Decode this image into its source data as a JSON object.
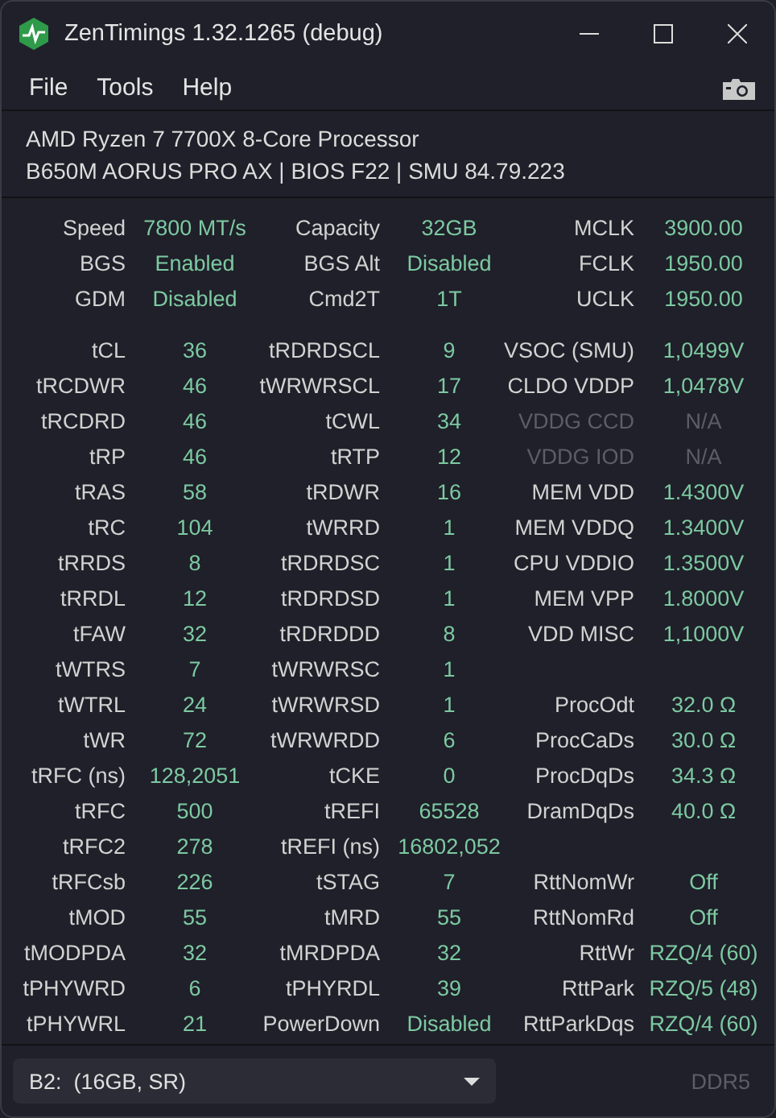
{
  "window": {
    "title": "ZenTimings 1.32.1265 (debug)"
  },
  "menu": [
    "File",
    "Tools",
    "Help"
  ],
  "info": {
    "cpu": "AMD Ryzen 7 7700X 8-Core Processor",
    "board": "B650M AORUS PRO AX | BIOS F22 | SMU 84.79.223"
  },
  "summary": [
    [
      {
        "label": "Speed",
        "value": "7800 MT/s",
        "disabled": false
      },
      {
        "label": "Capacity",
        "value": "32GB",
        "disabled": false
      },
      {
        "label": "MCLK",
        "value": "3900.00",
        "disabled": false
      }
    ],
    [
      {
        "label": "BGS",
        "value": "Enabled",
        "disabled": false
      },
      {
        "label": "BGS Alt",
        "value": "Disabled",
        "disabled": false
      },
      {
        "label": "FCLK",
        "value": "1950.00",
        "disabled": false
      }
    ],
    [
      {
        "label": "GDM",
        "value": "Disabled",
        "disabled": false
      },
      {
        "label": "Cmd2T",
        "value": "1T",
        "disabled": false
      },
      {
        "label": "UCLK",
        "value": "1950.00",
        "disabled": false
      }
    ]
  ],
  "timings": [
    [
      {
        "label": "tCL",
        "value": "36",
        "disabled": false
      },
      {
        "label": "tRDRDSCL",
        "value": "9",
        "disabled": false
      },
      {
        "label": "VSOC (SMU)",
        "value": "1,0499V",
        "disabled": false
      }
    ],
    [
      {
        "label": "tRCDWR",
        "value": "46",
        "disabled": false
      },
      {
        "label": "tWRWRSCL",
        "value": "17",
        "disabled": false
      },
      {
        "label": "CLDO VDDP",
        "value": "1,0478V",
        "disabled": false
      }
    ],
    [
      {
        "label": "tRCDRD",
        "value": "46",
        "disabled": false
      },
      {
        "label": "tCWL",
        "value": "34",
        "disabled": false
      },
      {
        "label": "VDDG CCD",
        "value": "N/A",
        "disabled": true
      }
    ],
    [
      {
        "label": "tRP",
        "value": "46",
        "disabled": false
      },
      {
        "label": "tRTP",
        "value": "12",
        "disabled": false
      },
      {
        "label": "VDDG IOD",
        "value": "N/A",
        "disabled": true
      }
    ],
    [
      {
        "label": "tRAS",
        "value": "58",
        "disabled": false
      },
      {
        "label": "tRDWR",
        "value": "16",
        "disabled": false
      },
      {
        "label": "MEM VDD",
        "value": "1.4300V",
        "disabled": false
      }
    ],
    [
      {
        "label": "tRC",
        "value": "104",
        "disabled": false
      },
      {
        "label": "tWRRD",
        "value": "1",
        "disabled": false
      },
      {
        "label": "MEM VDDQ",
        "value": "1.3400V",
        "disabled": false
      }
    ],
    [
      {
        "label": "tRRDS",
        "value": "8",
        "disabled": false
      },
      {
        "label": "tRDRDSC",
        "value": "1",
        "disabled": false
      },
      {
        "label": "CPU VDDIO",
        "value": "1.3500V",
        "disabled": false
      }
    ],
    [
      {
        "label": "tRRDL",
        "value": "12",
        "disabled": false
      },
      {
        "label": "tRDRDSD",
        "value": "1",
        "disabled": false
      },
      {
        "label": "MEM VPP",
        "value": "1.8000V",
        "disabled": false
      }
    ],
    [
      {
        "label": "tFAW",
        "value": "32",
        "disabled": false
      },
      {
        "label": "tRDRDDD",
        "value": "8",
        "disabled": false
      },
      {
        "label": "VDD MISC",
        "value": "1,1000V",
        "disabled": false
      }
    ],
    [
      {
        "label": "tWTRS",
        "value": "7",
        "disabled": false
      },
      {
        "label": "tWRWRSC",
        "value": "1",
        "disabled": false
      }
    ],
    [
      {
        "label": "tWTRL",
        "value": "24",
        "disabled": false
      },
      {
        "label": "tWRWRSD",
        "value": "1",
        "disabled": false
      },
      {
        "label": "ProcOdt",
        "value": "32.0 Ω",
        "disabled": false
      }
    ],
    [
      {
        "label": "tWR",
        "value": "72",
        "disabled": false
      },
      {
        "label": "tWRWRDD",
        "value": "6",
        "disabled": false
      },
      {
        "label": "ProcCaDs",
        "value": "30.0 Ω",
        "disabled": false
      }
    ],
    [
      {
        "label": "tRFC (ns)",
        "value": "128,2051",
        "disabled": false
      },
      {
        "label": "tCKE",
        "value": "0",
        "disabled": false
      },
      {
        "label": "ProcDqDs",
        "value": "34.3 Ω",
        "disabled": false
      }
    ],
    [
      {
        "label": "tRFC",
        "value": "500",
        "disabled": false
      },
      {
        "label": "tREFI",
        "value": "65528",
        "disabled": false
      },
      {
        "label": "DramDqDs",
        "value": "40.0 Ω",
        "disabled": false
      }
    ],
    [
      {
        "label": "tRFC2",
        "value": "278",
        "disabled": false
      },
      {
        "label": "tREFI (ns)",
        "value": "16802,052",
        "disabled": false
      }
    ],
    [
      {
        "label": "tRFCsb",
        "value": "226",
        "disabled": false
      },
      {
        "label": "tSTAG",
        "value": "7",
        "disabled": false
      },
      {
        "label": "RttNomWr",
        "value": "Off",
        "disabled": false
      }
    ],
    [
      {
        "label": "tMOD",
        "value": "55",
        "disabled": false
      },
      {
        "label": "tMRD",
        "value": "55",
        "disabled": false
      },
      {
        "label": "RttNomRd",
        "value": "Off",
        "disabled": false
      }
    ],
    [
      {
        "label": "tMODPDA",
        "value": "32",
        "disabled": false
      },
      {
        "label": "tMRDPDA",
        "value": "32",
        "disabled": false
      },
      {
        "label": "RttWr",
        "value": "RZQ/4 (60)",
        "disabled": false
      }
    ],
    [
      {
        "label": "tPHYWRD",
        "value": "6",
        "disabled": false
      },
      {
        "label": "tPHYRDL",
        "value": "39",
        "disabled": false
      },
      {
        "label": "RttPark",
        "value": "RZQ/5 (48)",
        "disabled": false
      }
    ],
    [
      {
        "label": "tPHYWRL",
        "value": "21",
        "disabled": false
      },
      {
        "label": "PowerDown",
        "value": "Disabled",
        "disabled": false
      },
      {
        "label": "RttParkDqs",
        "value": "RZQ/4 (60)",
        "disabled": false
      }
    ]
  ],
  "footer": {
    "module": "B2:  (16GB, SR)",
    "memory_type": "DDR5"
  }
}
